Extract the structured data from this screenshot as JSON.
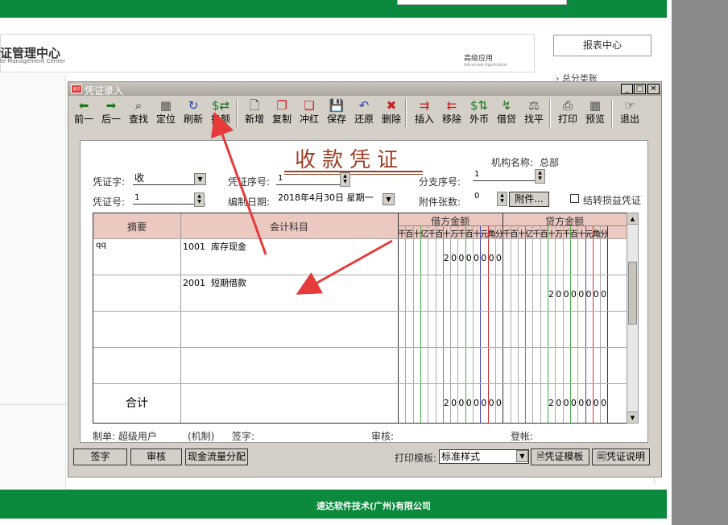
{
  "background": {
    "center_title": "证管理中心",
    "center_subtitle": "te Management Center",
    "advanced": "高级应用",
    "advanced_sub": "Advanced Application",
    "report_center": "报表中心",
    "general_ledger": "› 总分类账",
    "company": "速达软件技术(广州)有限公司"
  },
  "window": {
    "title": "凭证录入",
    "icon_text": "速达"
  },
  "toolbar": [
    {
      "label": "前一",
      "icon": "arrow-left-icon",
      "glyph": "⬅",
      "color": "#1a7a1a"
    },
    {
      "label": "后一",
      "icon": "arrow-right-icon",
      "glyph": "➡",
      "color": "#1a7a1a"
    },
    {
      "label": "查找",
      "icon": "find-icon",
      "glyph": "⌕",
      "color": "#333"
    },
    {
      "label": "定位",
      "icon": "locate-icon",
      "glyph": "▦",
      "color": "#555"
    },
    {
      "label": "刷新",
      "icon": "refresh-icon",
      "glyph": "↻",
      "color": "#2244aa"
    },
    {
      "label": "换额",
      "icon": "swap-amount-icon",
      "glyph": "$⇄",
      "color": "#1a7a1a"
    },
    {
      "label": "新增",
      "icon": "new-doc-icon",
      "glyph": "🗋",
      "color": "#333"
    },
    {
      "label": "复制",
      "icon": "copy-icon",
      "glyph": "❐",
      "color": "#c22"
    },
    {
      "label": "冲红",
      "icon": "reverse-icon",
      "glyph": "❏",
      "color": "#c22"
    },
    {
      "label": "保存",
      "icon": "save-icon",
      "glyph": "💾",
      "color": "#2244aa"
    },
    {
      "label": "还原",
      "icon": "undo-icon",
      "glyph": "↶",
      "color": "#2244aa"
    },
    {
      "label": "删除",
      "icon": "delete-icon",
      "glyph": "✖",
      "color": "#c22"
    },
    {
      "label": "插入",
      "icon": "insert-row-icon",
      "glyph": "⇉",
      "color": "#c22"
    },
    {
      "label": "移除",
      "icon": "remove-row-icon",
      "glyph": "⇇",
      "color": "#c22"
    },
    {
      "label": "外币",
      "icon": "foreign-currency-icon",
      "glyph": "$⇅",
      "color": "#1a7a1a"
    },
    {
      "label": "借贷",
      "icon": "debit-credit-icon",
      "glyph": "↯",
      "color": "#1a7a1a"
    },
    {
      "label": "找平",
      "icon": "balance-icon",
      "glyph": "⚖",
      "color": "#555"
    },
    {
      "label": "打印",
      "icon": "print-icon",
      "glyph": "⎙",
      "color": "#333"
    },
    {
      "label": "预览",
      "icon": "preview-icon",
      "glyph": "▦",
      "color": "#555"
    },
    {
      "label": "退出",
      "icon": "exit-icon",
      "glyph": "☞",
      "color": "#333"
    }
  ],
  "voucher": {
    "title": "收款凭证",
    "org_label": "机构名称:",
    "org_value": "总部",
    "type_label": "凭证字:",
    "type_value": "收",
    "seq_label": "凭证序号:",
    "seq_value": "1",
    "branch_label": "分支序号:",
    "branch_value": "1",
    "num_label": "凭证号:",
    "num_value": "1",
    "date_label": "编制日期:",
    "date_value": "2018年4月30日",
    "weekday": "星期一",
    "attach_label": "附件张数:",
    "attach_value": "0",
    "attach_button": "附件...",
    "transfer_label": "结转损益凭证"
  },
  "table": {
    "headers": {
      "summary": "摘要",
      "account": "会计科目",
      "debit": "借方金额",
      "credit": "贷方金额"
    },
    "units": [
      "千",
      "百",
      "十",
      "亿",
      "千",
      "百",
      "十",
      "万",
      "千",
      "百",
      "十",
      "元",
      "角",
      "分"
    ],
    "rows": [
      {
        "summary": "qq",
        "account": "1001  库存现金",
        "debit": "20000000",
        "credit": ""
      },
      {
        "summary": "",
        "account": "2001  短期借款",
        "debit": "",
        "credit": "20000000"
      },
      {
        "summary": "",
        "account": "",
        "debit": "",
        "credit": ""
      },
      {
        "summary": "",
        "account": "",
        "debit": "",
        "credit": ""
      }
    ],
    "total_label": "合计",
    "total_debit": "20000000",
    "total_credit": "20000000"
  },
  "footer": {
    "maker": "制单: 超级用户",
    "org": "(机制)",
    "sign": "签字:",
    "audit": "审核:",
    "post": "登帐:"
  },
  "buttons": {
    "sign": "签字",
    "audit": "审核",
    "cashflow": "现金流量分配",
    "print_template_label": "打印模板:",
    "print_template_value": "标准样式",
    "voucher_template": "凭证模板",
    "voucher_note": "凭证说明"
  },
  "colors": {
    "green": "#0b8a3e",
    "header_pink": "#ecc9c0",
    "title_brown": "#9a4025",
    "arrow_red": "#e53b3b"
  }
}
